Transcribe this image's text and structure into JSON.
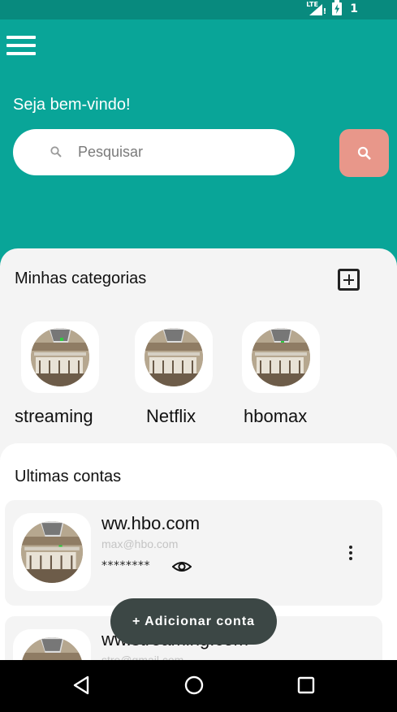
{
  "status_bar": {
    "network_label": "LTE",
    "notification_count": "1"
  },
  "header": {
    "welcome_text": "Seja bem-vindo!",
    "search_placeholder": "Pesquisar"
  },
  "categories": {
    "title": "Minhas categorias",
    "items": [
      {
        "label": "streaming"
      },
      {
        "label": "Netflix"
      },
      {
        "label": "hbomax"
      }
    ]
  },
  "accounts": {
    "title": "Ultimas contas",
    "items": [
      {
        "site": "ww.hbo.com",
        "email": "max@hbo.com",
        "password_mask": "********"
      },
      {
        "site": "ww.streaming.com",
        "email": "stre@gmail.com",
        "password_mask": "********"
      }
    ]
  },
  "fab": {
    "label": "+ Adicionar conta"
  },
  "colors": {
    "primary": "#09A598",
    "status_bar": "#088A7E",
    "accent_button": "#E8978A",
    "panel": "#F4F4F4",
    "fab": "#3C4745"
  },
  "icons": {
    "menu": "hamburger-menu-icon",
    "search": "search-icon",
    "add_category": "add-box-icon",
    "toggle_password": "eye-icon",
    "more": "more-vertical-icon",
    "nav_back": "triangle-back-icon",
    "nav_home": "circle-home-icon",
    "nav_recents": "square-recents-icon"
  }
}
